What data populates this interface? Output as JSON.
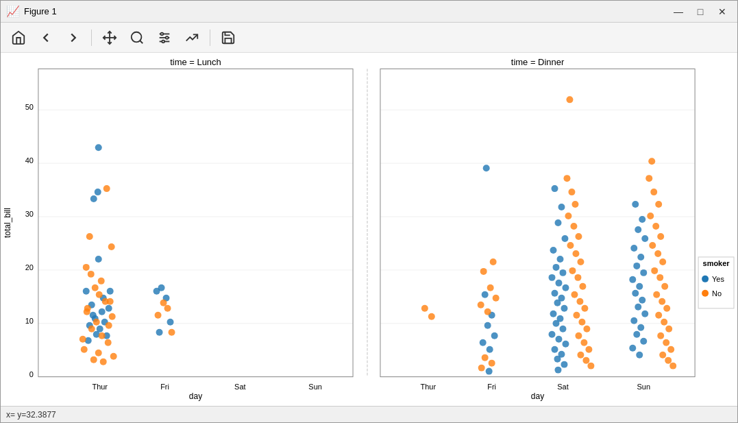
{
  "window": {
    "title": "Figure 1",
    "icon": "📈"
  },
  "title_buttons": {
    "minimize": "—",
    "maximize": "□",
    "close": "✕"
  },
  "toolbar": {
    "home_label": "⌂",
    "back_label": "←",
    "forward_label": "→",
    "pan_label": "✛",
    "zoom_label": "🔍",
    "configure_label": "⚙",
    "save_label": "💾",
    "home_tooltip": "Home",
    "back_tooltip": "Back",
    "forward_tooltip": "Forward",
    "pan_tooltip": "Pan",
    "zoom_tooltip": "Zoom",
    "configure_tooltip": "Configure subplots",
    "save_tooltip": "Save figure"
  },
  "status_bar": {
    "text": "x= y=32.3877"
  },
  "plot": {
    "left_title": "time = Lunch",
    "right_title": "time = Dinner",
    "y_label": "total_bill",
    "x_label_left": "day",
    "x_label_right": "day",
    "y_ticks": [
      "0",
      "10",
      "20",
      "30",
      "40",
      "50"
    ],
    "x_ticks_left": [
      "Thur",
      "Fri",
      "Sat",
      "Sun"
    ],
    "x_ticks_right": [
      "Thur",
      "Fri",
      "Sat",
      "Sun"
    ],
    "legend": {
      "title": "smoker",
      "yes_label": "Yes",
      "no_label": "No",
      "yes_color": "#1f77b4",
      "no_color": "#ff7f0e"
    }
  }
}
